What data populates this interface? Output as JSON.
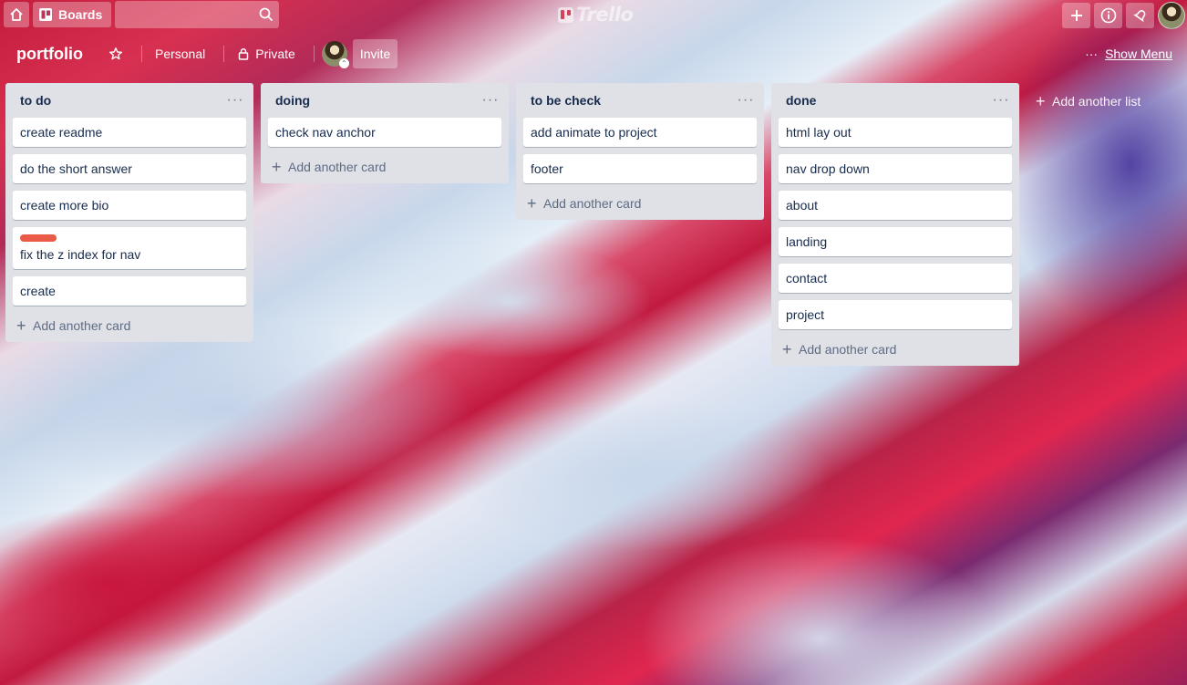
{
  "topbar": {
    "boards_label": "Boards",
    "search_placeholder": "",
    "logo_text": "Trello"
  },
  "board": {
    "title": "portfolio",
    "team": "Personal",
    "visibility": "Private",
    "invite_label": "Invite",
    "show_menu_label": "Show Menu"
  },
  "lists": [
    {
      "title": "to do",
      "cards": [
        {
          "text": "create readme"
        },
        {
          "text": "do the short answer"
        },
        {
          "text": "create more bio"
        },
        {
          "text": "fix the z index for nav",
          "label_color": "#eb5a46"
        },
        {
          "text": "create"
        }
      ],
      "add_card_label": "Add another card"
    },
    {
      "title": "doing",
      "cards": [
        {
          "text": "check nav anchor"
        }
      ],
      "add_card_label": "Add another card"
    },
    {
      "title": "to be check",
      "cards": [
        {
          "text": "add animate to project"
        },
        {
          "text": "footer"
        }
      ],
      "add_card_label": "Add another card"
    },
    {
      "title": "done",
      "cards": [
        {
          "text": "html lay out"
        },
        {
          "text": "nav drop down"
        },
        {
          "text": "about"
        },
        {
          "text": "landing"
        },
        {
          "text": "contact"
        },
        {
          "text": "project"
        }
      ],
      "add_card_label": "Add another card"
    }
  ],
  "add_list_label": "Add another list",
  "colors": {
    "list_bg": "#dfe1e6",
    "label_red": "#eb5a46"
  }
}
